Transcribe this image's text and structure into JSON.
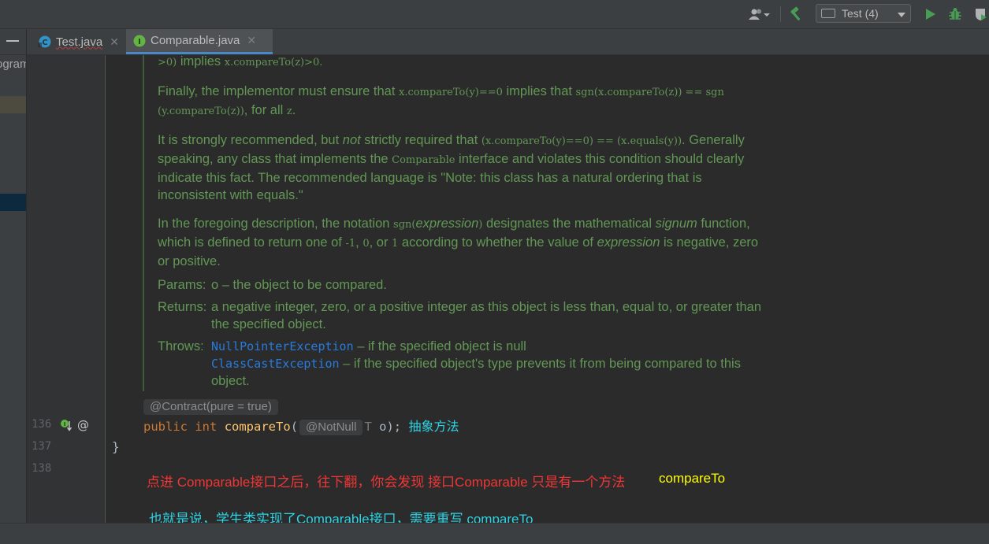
{
  "toolbar": {
    "run_config": "Test (4)",
    "icons": [
      "user-account-icon",
      "build-hammer-icon",
      "run-icon",
      "debug-icon",
      "coverage-icon"
    ]
  },
  "tabs": [
    {
      "label": "Test.java",
      "icon": "java-class-icon",
      "active": false
    },
    {
      "label": "Comparable.java",
      "icon": "java-interface-icon",
      "active": true
    }
  ],
  "project_fragment": "ogram",
  "doc": {
    "p1": {
      "code_a": ">0)",
      "text_a": " implies ",
      "code_b": "x.compareTo(z)>0."
    },
    "p2": {
      "text_a": "Finally, the implementor must ensure that ",
      "code_a": "x.compareTo(y)==0",
      "text_b": " implies that ",
      "code_b": "sgn(x.compareTo(z)) == sgn (y.compareTo(z))",
      "text_c": ", for all ",
      "code_c": "z",
      "text_d": "."
    },
    "p3": {
      "text_a": "It is strongly recommended, but ",
      "em": "not",
      "text_b": " strictly required that ",
      "code_a": "(x.compareTo(y)==0) == (x.equals(y))",
      "text_c": ". Generally speaking, any class that implements the ",
      "code_b": "Comparable",
      "text_d": " interface and violates this condition should clearly indicate this fact. The recommended language is \"Note: this class has a natural ordering that is inconsistent with equals.\""
    },
    "p4": {
      "text_a": "In the foregoing description, the notation ",
      "code_a": "sgn(",
      "em_a": "expression",
      "code_b": ")",
      "text_b": " designates the mathematical ",
      "em_b": "signum",
      "text_c": " function, which is defined to return one of ",
      "code_c": "-1",
      "text_d": ", ",
      "code_d": "0",
      "text_e": ", or ",
      "code_e": "1",
      "text_f": " according to whether the value of ",
      "em_c": "expression",
      "text_g": " is negative, zero or positive."
    },
    "params_label": "Params:",
    "params_value": "o – the object to be compared.",
    "returns_label": "Returns:",
    "returns_value": "a negative integer, zero, or a positive integer as this object is less than, equal to, or greater than the specified object.",
    "throws_label": "Throws:",
    "throws_1_name": "NullPointerException",
    "throws_1_text": " – if the specified object is null",
    "throws_2_name": "ClassCastException",
    "throws_2_text": " – if the specified object's type prevents it from being compared to this object."
  },
  "code": {
    "contract_hint": "@Contract(pure = true)",
    "kw_public": "public",
    "kw_int": "int",
    "method_name": "compareTo",
    "paren_open": "(",
    "param_hint": "@NotNull",
    "param_type": "T",
    "param_rest": " o);",
    "method_note": "抽象方法",
    "closing_brace": "}"
  },
  "line_numbers": [
    "136",
    "137",
    "138"
  ],
  "notes": {
    "red": "点进 Comparable接口之后，往下翻，你会发现 接口Comparable 只是有一个方法",
    "yellow": "compareTo",
    "bottom": "也就是说，学生类实现了Comparable接口，需要重写 compareTo"
  },
  "colors": {
    "doc_text": "#629755",
    "link": "#287bde",
    "keyword": "#cc7832",
    "method": "#ffc66d",
    "note_red": "#f03636",
    "note_yellow": "#ffff00",
    "note_cyan": "#2dd4e6"
  }
}
